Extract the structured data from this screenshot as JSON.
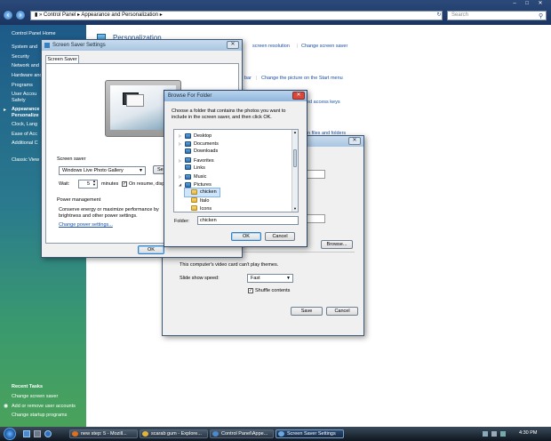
{
  "control_panel": {
    "address": [
      "Control Panel",
      "Appearance and Personalization"
    ],
    "search_placeholder": "Search",
    "left_nav": [
      "Control Panel Home",
      "System and",
      "Security",
      "Network and",
      "Hardware and",
      "Programs",
      "User Accou",
      "Safety",
      "Appearance",
      "Personalize",
      "Clock, Lang",
      "Ease of Acc",
      "Additional C",
      "Classic View"
    ],
    "recent_tasks_title": "Recent Tasks",
    "recent_tasks": [
      "Change screen saver",
      "Add or remove user accounts",
      "Change startup programs"
    ],
    "heading": "Personalization",
    "links_row1": [
      "screen resolution",
      "Change screen saver"
    ],
    "links_row2": [
      "bar",
      "Change the picture on the Start menu"
    ],
    "links_row3": [
      "ed access keys"
    ],
    "links_row4": [
      "en files and folders"
    ]
  },
  "screen_saver_window": {
    "title": "Screen Saver Settings",
    "tab": "Screen Saver",
    "screen_saver_group": "Screen saver",
    "screen_saver_value": "Windows Live Photo Gallery",
    "settings_button": "Se",
    "wait_label": "Wait:",
    "wait_value": "5",
    "minutes_label": "minutes",
    "resume_label": "On resume, disp",
    "power_group": "Power management",
    "power_text_1": "Conserve energy or maximize performance by",
    "power_text_2": "brightness and other power settings.",
    "power_link": "Change power settings...",
    "ok": "OK"
  },
  "photo_settings_window": {
    "browse": "Browse...",
    "themes_text": "This computer's video card can't play themes.",
    "speed_label": "Slide show speed:",
    "speed_value": "Fast",
    "shuffle_label": "Shuffle contents",
    "save": "Save",
    "cancel": "Cancel"
  },
  "browse_dialog": {
    "title": "Browse For Folder",
    "instruction_1": "Choose a folder that contains the photos you want to",
    "instruction_2": "include in the screen saver, and then click OK.",
    "tree": [
      {
        "label": "Desktop",
        "icon": "library",
        "expander": "▷",
        "indent": 0
      },
      {
        "label": "Documents",
        "icon": "library",
        "expander": "▷",
        "indent": 0
      },
      {
        "label": "Downloads",
        "icon": "library",
        "expander": "",
        "indent": 0
      },
      {
        "label": "Favorites",
        "icon": "library",
        "expander": "▷",
        "indent": 0
      },
      {
        "label": "Links",
        "icon": "library",
        "expander": "",
        "indent": 0
      },
      {
        "label": "Music",
        "icon": "library",
        "expander": "▷",
        "indent": 0
      },
      {
        "label": "Pictures",
        "icon": "library",
        "expander": "◢",
        "indent": 0
      },
      {
        "label": "chicken",
        "icon": "folder",
        "expander": "",
        "indent": 1,
        "selected": true
      },
      {
        "label": "Italo",
        "icon": "folder",
        "expander": "",
        "indent": 1
      },
      {
        "label": "Icons",
        "icon": "folder",
        "expander": "",
        "indent": 1
      }
    ],
    "folder_label": "Folder:",
    "folder_value": "chicken",
    "ok": "OK",
    "cancel": "Cancel"
  },
  "taskbar": {
    "buttons": [
      "new step: 5 - Mozill...",
      "scarab gum - Explore...",
      "Control Panel\\Appe...",
      "Screen Saver Settings"
    ],
    "clock": "4:30 PM",
    "accent": "#1b3460"
  }
}
